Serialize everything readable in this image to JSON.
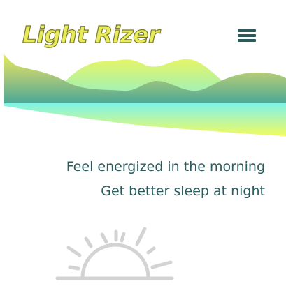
{
  "header": {
    "brand": "Light Rizer",
    "menu_icon": "hamburger-menu-icon"
  },
  "hero": {
    "illustration_icon": "mountains-lake-illustration",
    "taglines": [
      "Feel energized in the morning",
      "Get better sleep at night"
    ]
  },
  "decor": {
    "sun_icon": "sunrise-icon"
  },
  "colors": {
    "brand_yellow": "#e8ec5a",
    "teal": "#2a5c5e",
    "aqua": "#7ef0e0",
    "sun_gray": "#d3d3d3"
  }
}
